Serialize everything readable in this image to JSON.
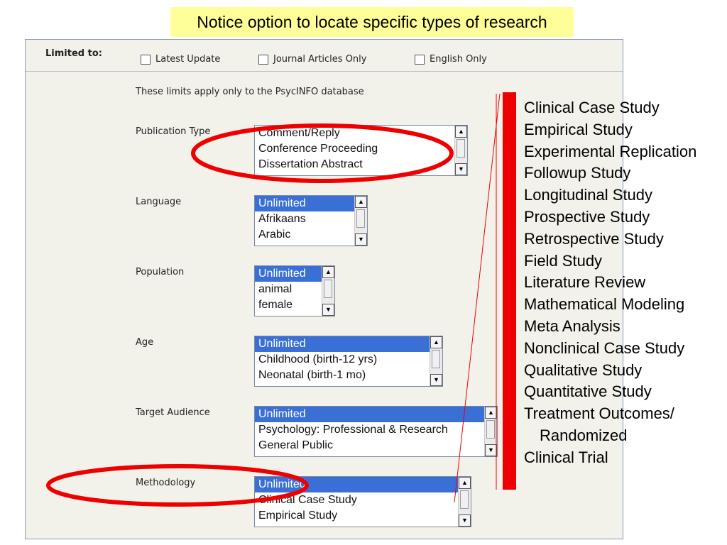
{
  "banner": {
    "text": "Notice option to locate specific types of research"
  },
  "form": {
    "limited_to_label": "Limited to:",
    "checkboxes": [
      {
        "label": "Latest Update",
        "checked": false
      },
      {
        "label": "Journal Articles Only",
        "checked": false
      },
      {
        "label": "English Only",
        "checked": false
      }
    ],
    "note": "These limits apply only to the PsycINFO database",
    "fields": {
      "publication_type": {
        "label": "Publication Type",
        "options": [
          "Comment/Reply",
          "Conference Proceeding",
          "Dissertation Abstract"
        ]
      },
      "language": {
        "label": "Language",
        "options": [
          "Unlimited",
          "Afrikaans",
          "Arabic"
        ]
      },
      "population": {
        "label": "Population",
        "options": [
          "Unlimited",
          "animal",
          "female"
        ]
      },
      "age": {
        "label": "Age",
        "options": [
          "Unlimited",
          "Childhood (birth-12 yrs)",
          "Neonatal (birth-1 mo)"
        ]
      },
      "target_audience": {
        "label": "Target Audience",
        "options": [
          "Unlimited",
          "Psychology: Professional & Research",
          "General Public"
        ]
      },
      "methodology": {
        "label": "Methodology",
        "options": [
          "Unlimited",
          "Clinical Case Study",
          "Empirical Study"
        ]
      }
    }
  },
  "methodology_list": [
    "Clinical Case Study",
    "Empirical Study",
    "Experimental Replication",
    "Followup Study",
    "Longitudinal Study",
    "Prospective Study",
    "Retrospective Study",
    "Field Study",
    "Literature Review",
    "Mathematical Modeling",
    "Meta Analysis",
    "Nonclinical Case Study",
    "Qualitative Study",
    "Quantitative Study",
    "Treatment Outcomes/",
    "Randomized",
    "Clinical Trial"
  ],
  "colors": {
    "banner_bg": "#ffff99",
    "highlight": "#ee0000",
    "selected_option": "#3a6fd6"
  },
  "icons": {
    "scroll_up": "▲",
    "scroll_down": "▼"
  }
}
